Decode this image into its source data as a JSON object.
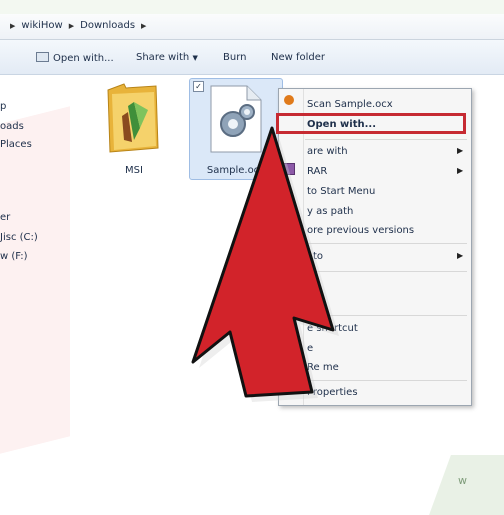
{
  "breadcrumb": [
    "wikiHow",
    "Downloads"
  ],
  "toolbar": {
    "open_with": "Open with...",
    "share_with": "Share with",
    "burn": "Burn",
    "new_folder": "New folder"
  },
  "nav": {
    "items": [
      "p",
      "oads",
      "Places",
      "er",
      "Jisc (C:)",
      "w (F:)"
    ]
  },
  "files": [
    {
      "name": "MSI"
    },
    {
      "name": "Sample.ocx"
    }
  ],
  "context_menu": {
    "items": [
      "Scan Sample.ocx",
      "Open with...",
      "are with",
      "RAR",
      "to Start Menu",
      "y as path",
      "ore previous versions",
      "l to",
      "y",
      "e shortcut",
      "e",
      "Re me",
      "Properties"
    ]
  },
  "colors": {
    "highlight": "#c62a32",
    "arrow": "#d2232a",
    "selection": "#dbe8f8"
  }
}
